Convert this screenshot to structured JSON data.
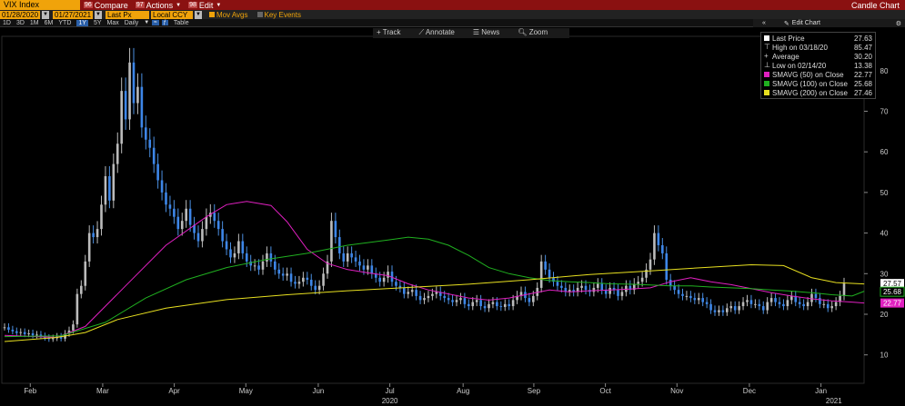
{
  "header": {
    "ticker": "VIX Index",
    "buttons": [
      {
        "num": "96",
        "label": "Compare"
      },
      {
        "num": "97",
        "label": "Actions"
      },
      {
        "num": "98",
        "label": "Edit"
      }
    ],
    "title": "Candle Chart"
  },
  "controls": {
    "start_date": "01/28/2020",
    "end_date": "01/27/2021",
    "field": "Last Px",
    "currency": "Local CCY",
    "mov_avgs": "Mov Avgs",
    "key_events": "Key Events"
  },
  "periods": [
    "1D",
    "3D",
    "1M",
    "6M",
    "YTD",
    "1Y",
    "5Y",
    "Max"
  ],
  "active_period": "1Y",
  "frequency": "Daily",
  "table_label": "Table",
  "edit_chart": "Edit Chart",
  "tools": [
    "Track",
    "Annotate",
    "News",
    "Zoom"
  ],
  "legend": [
    {
      "name": "Last Price",
      "value": "27.63",
      "color": "#ffffff"
    },
    {
      "name": "High on 03/18/20",
      "value": "85.47",
      "color": ""
    },
    {
      "name": "Average",
      "value": "30.20",
      "color": ""
    },
    {
      "name": "Low on 02/14/20",
      "value": "13.38",
      "color": ""
    },
    {
      "name": "SMAVG (50)  on Close",
      "value": "22.77",
      "color": "#e020c0"
    },
    {
      "name": "SMAVG (100)  on Close",
      "value": "25.68",
      "color": "#20b020"
    },
    {
      "name": "SMAVG (200)  on Close",
      "value": "27.46",
      "color": "#e8e020"
    }
  ],
  "chart_data": {
    "type": "candlestick",
    "y_ticks": [
      10,
      20,
      30,
      40,
      50,
      60,
      70,
      80
    ],
    "ylim": [
      3,
      88
    ],
    "month_ticks": [
      {
        "label": "Feb",
        "t": 0.033
      },
      {
        "label": "Mar",
        "t": 0.117
      },
      {
        "label": "Apr",
        "t": 0.2
      },
      {
        "label": "May",
        "t": 0.283
      },
      {
        "label": "Jun",
        "t": 0.367
      },
      {
        "label": "Jul",
        "t": 0.45
      },
      {
        "label": "Aug",
        "t": 0.535
      },
      {
        "label": "Sep",
        "t": 0.617
      },
      {
        "label": "Oct",
        "t": 0.7
      },
      {
        "label": "Nov",
        "t": 0.783
      },
      {
        "label": "Dec",
        "t": 0.867
      },
      {
        "label": "Jan",
        "t": 0.95
      }
    ],
    "year_labels": [
      {
        "label": "2020",
        "t": 0.45
      },
      {
        "label": "2021",
        "t": 0.965
      }
    ],
    "last_price_tags": [
      {
        "value": "27.57",
        "num": 27.57,
        "color": "#ffffff"
      },
      {
        "value": "25.68",
        "num": 25.68,
        "color": "#20b020"
      },
      {
        "value": "22.77",
        "num": 22.77,
        "color": "#e020c0"
      }
    ],
    "closes": [
      16.8,
      16.2,
      15.8,
      15.4,
      15.6,
      15.1,
      15.3,
      14.8,
      15.0,
      14.6,
      14.2,
      13.9,
      14.1,
      14.5,
      14.0,
      15.2,
      16.0,
      17.5,
      25.0,
      27.0,
      33.0,
      40.0,
      39.0,
      41.0,
      47.0,
      54.0,
      48.0,
      57.0,
      62.0,
      75.0,
      68.0,
      82.0,
      72.0,
      76.0,
      66.0,
      63.0,
      61.0,
      57.0,
      53.0,
      50.0,
      47.0,
      46.0,
      44.0,
      41.0,
      43.0,
      46.0,
      42.0,
      40.0,
      38.0,
      41.0,
      44.0,
      45.0,
      43.0,
      41.0,
      38.0,
      36.0,
      34.0,
      35.0,
      38.0,
      35.0,
      33.0,
      32.0,
      32.0,
      31.0,
      33.0,
      35.0,
      33.0,
      31.0,
      30.0,
      29.5,
      30.0,
      28.0,
      27.5,
      28.0,
      29.0,
      28.5,
      27.0,
      26.0,
      27.0,
      30.0,
      33.0,
      43.0,
      39.0,
      35.0,
      33.0,
      35.0,
      34.0,
      33.0,
      32.0,
      31.0,
      32.0,
      30.0,
      29.0,
      28.0,
      29.0,
      30.5,
      28.0,
      27.0,
      26.5,
      25.0,
      25.5,
      26.0,
      24.5,
      23.5,
      24.0,
      24.5,
      25.0,
      25.5,
      24.5,
      24.0,
      23.5,
      23.0,
      23.5,
      24.0,
      22.5,
      22.0,
      23.0,
      23.5,
      22.0,
      21.5,
      22.5,
      23.0,
      22.0,
      21.8,
      22.5,
      22.0,
      23.5,
      24.5,
      25.5,
      24.0,
      23.0,
      24.5,
      26.5,
      33.0,
      31.0,
      29.0,
      28.0,
      27.0,
      26.5,
      25.5,
      26.0,
      25.5,
      26.5,
      27.0,
      26.0,
      25.5,
      26.5,
      27.5,
      26.0,
      25.0,
      26.5,
      26.0,
      24.5,
      25.5,
      27.0,
      26.0,
      27.5,
      28.0,
      29.0,
      31.0,
      33.5,
      40.0,
      37.0,
      35.0,
      28.5,
      27.0,
      26.0,
      25.0,
      24.5,
      24.5,
      24.0,
      23.5,
      24.0,
      23.0,
      22.5,
      21.0,
      20.5,
      21.0,
      20.5,
      21.5,
      22.0,
      21.0,
      22.0,
      23.0,
      23.5,
      22.5,
      22.5,
      22.0,
      21.0,
      23.0,
      24.0,
      23.0,
      22.5,
      22.0,
      23.5,
      24.5,
      23.0,
      22.5,
      22.0,
      23.0,
      25.0,
      24.0,
      22.5,
      22.5,
      21.5,
      22.0,
      23.0,
      24.5,
      27.57
    ],
    "sma_lines": [
      {
        "name": "SMAVG (50)",
        "color": "#e020c0",
        "values": [
          [
            0,
            14.8
          ],
          [
            13,
            14.3
          ],
          [
            20,
            17
          ],
          [
            30,
            27
          ],
          [
            40,
            37
          ],
          [
            50,
            44
          ],
          [
            55,
            47
          ],
          [
            60,
            47.8
          ],
          [
            66,
            46.8
          ],
          [
            70,
            42.8
          ],
          [
            75,
            36
          ],
          [
            80,
            32.5
          ],
          [
            85,
            31
          ],
          [
            90,
            30.2
          ],
          [
            95,
            29.5
          ],
          [
            100,
            27.5
          ],
          [
            105,
            26
          ],
          [
            110,
            25
          ],
          [
            115,
            24
          ],
          [
            120,
            23.5
          ],
          [
            125,
            24
          ],
          [
            130,
            25
          ],
          [
            135,
            26
          ],
          [
            140,
            25.5
          ],
          [
            145,
            25.8
          ],
          [
            150,
            26
          ],
          [
            155,
            26.2
          ],
          [
            160,
            26.5
          ],
          [
            165,
            28
          ],
          [
            170,
            29
          ],
          [
            175,
            28
          ],
          [
            180,
            27.3
          ],
          [
            185,
            26.3
          ],
          [
            190,
            25.3
          ],
          [
            195,
            24.5
          ],
          [
            200,
            23.8
          ],
          [
            205,
            23.3
          ],
          [
            210,
            23
          ],
          [
            213,
            22.77
          ]
        ]
      },
      {
        "name": "SMAVG (100)",
        "color": "#20b020",
        "values": [
          [
            0,
            14.5
          ],
          [
            14,
            14.7
          ],
          [
            25,
            18
          ],
          [
            35,
            24
          ],
          [
            45,
            28.5
          ],
          [
            55,
            31.5
          ],
          [
            65,
            33.5
          ],
          [
            75,
            35
          ],
          [
            85,
            37
          ],
          [
            95,
            38.3
          ],
          [
            100,
            39
          ],
          [
            105,
            38.5
          ],
          [
            110,
            37
          ],
          [
            115,
            34.5
          ],
          [
            120,
            31.5
          ],
          [
            125,
            30
          ],
          [
            130,
            29
          ],
          [
            135,
            28.3
          ],
          [
            140,
            28
          ],
          [
            145,
            27.8
          ],
          [
            150,
            27.5
          ],
          [
            155,
            27.4
          ],
          [
            160,
            27.2
          ],
          [
            165,
            27
          ],
          [
            170,
            27
          ],
          [
            175,
            26.7
          ],
          [
            180,
            26.5
          ],
          [
            185,
            26.3
          ],
          [
            190,
            26
          ],
          [
            195,
            25.7
          ],
          [
            200,
            25.3
          ],
          [
            205,
            24.8
          ],
          [
            210,
            24.5
          ],
          [
            213,
            25.68
          ]
        ]
      },
      {
        "name": "SMAVG (200)",
        "color": "#e8e020",
        "values": [
          [
            0,
            13.3
          ],
          [
            13,
            14.3
          ],
          [
            20,
            15.5
          ],
          [
            28,
            18.7
          ],
          [
            40,
            21.5
          ],
          [
            55,
            23.6
          ],
          [
            70,
            24.8
          ],
          [
            85,
            25.8
          ],
          [
            100,
            26.6
          ],
          [
            115,
            27.4
          ],
          [
            130,
            28.5
          ],
          [
            145,
            29.8
          ],
          [
            160,
            30.7
          ],
          [
            175,
            31.6
          ],
          [
            185,
            32.2
          ],
          [
            193,
            32
          ],
          [
            200,
            29
          ],
          [
            206,
            27.8
          ],
          [
            213,
            27.46
          ]
        ]
      }
    ]
  }
}
